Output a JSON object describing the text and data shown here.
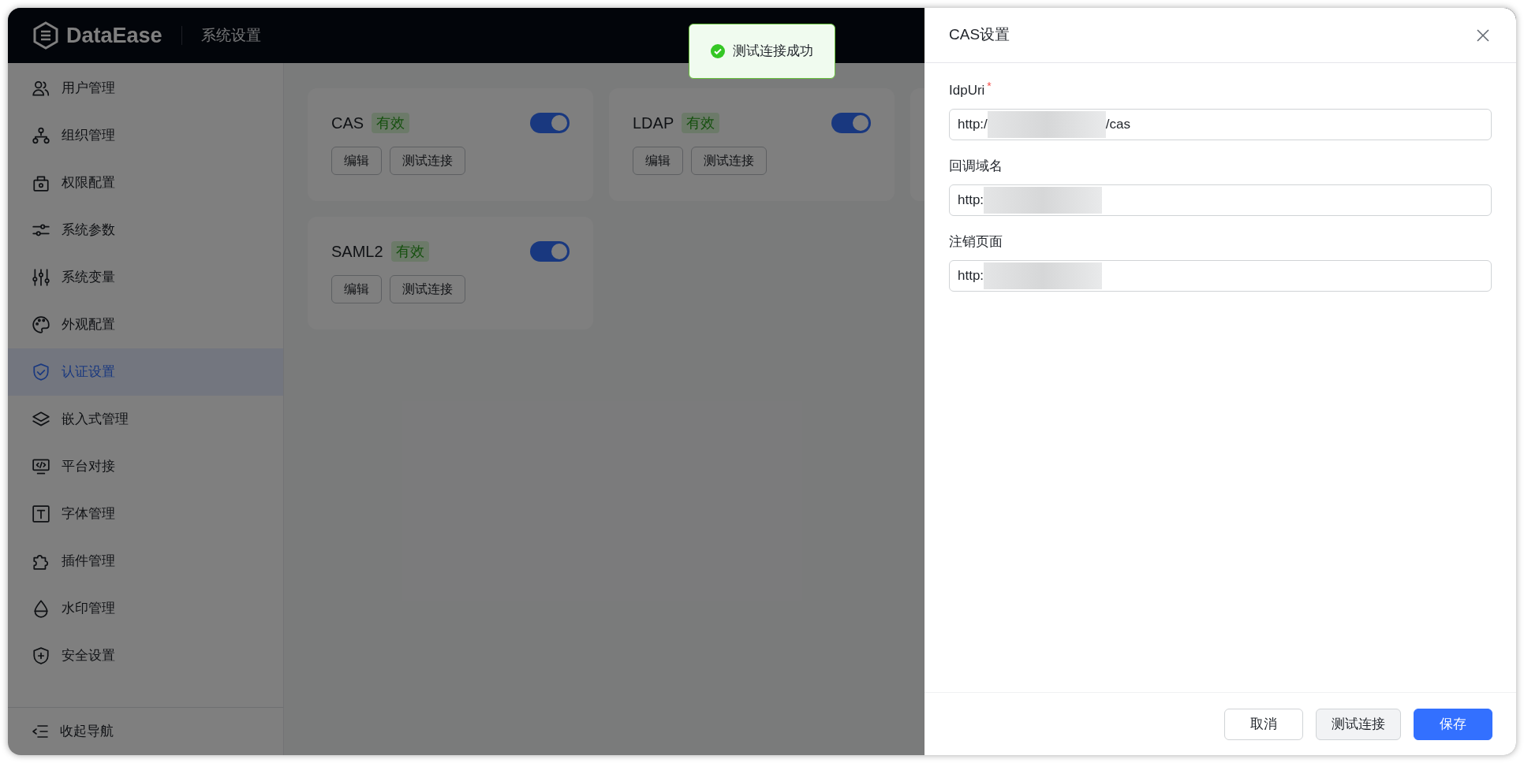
{
  "app": {
    "logo_text": "DataEase",
    "section_title": "系统设置"
  },
  "sidebar": {
    "items": [
      {
        "label": "用户管理",
        "selected": false
      },
      {
        "label": "组织管理",
        "selected": false
      },
      {
        "label": "权限配置",
        "selected": false
      },
      {
        "label": "系统参数",
        "selected": false
      },
      {
        "label": "系统变量",
        "selected": false
      },
      {
        "label": "外观配置",
        "selected": false
      },
      {
        "label": "认证设置",
        "selected": true
      },
      {
        "label": "嵌入式管理",
        "selected": false
      },
      {
        "label": "平台对接",
        "selected": false
      },
      {
        "label": "字体管理",
        "selected": false
      },
      {
        "label": "插件管理",
        "selected": false
      },
      {
        "label": "水印管理",
        "selected": false
      },
      {
        "label": "安全设置",
        "selected": false
      }
    ],
    "collapse": {
      "label": "收起导航"
    }
  },
  "cards": [
    {
      "kind": "auth",
      "name": "CAS",
      "status": "有效",
      "enabled": true,
      "actions": [
        "编辑",
        "测试连接"
      ]
    },
    {
      "kind": "auth",
      "name": "LDAP",
      "status": "有效",
      "enabled": true,
      "actions": [
        "编辑",
        "测试连接"
      ]
    },
    {
      "kind": "covered"
    },
    {
      "kind": "auth",
      "name": "SAML2",
      "status": "有效",
      "enabled": true,
      "actions": [
        "编辑",
        "测试连接"
      ]
    }
  ],
  "toast": {
    "kind": "success",
    "message": "测试连接成功"
  },
  "drawer": {
    "title": "CAS设置",
    "fields": [
      {
        "label": "IdpUri",
        "required_mark": "*",
        "value_start": "http:/",
        "value_end": "/cas"
      },
      {
        "label": "回调域名",
        "value_start": "http:"
      },
      {
        "label": "注销页面",
        "value_start": "http:"
      }
    ],
    "buttons": [
      {
        "label": "取消",
        "kind": "default"
      },
      {
        "label": "测试连接",
        "kind": "secondary"
      },
      {
        "label": "保存",
        "kind": "primary"
      }
    ]
  }
}
